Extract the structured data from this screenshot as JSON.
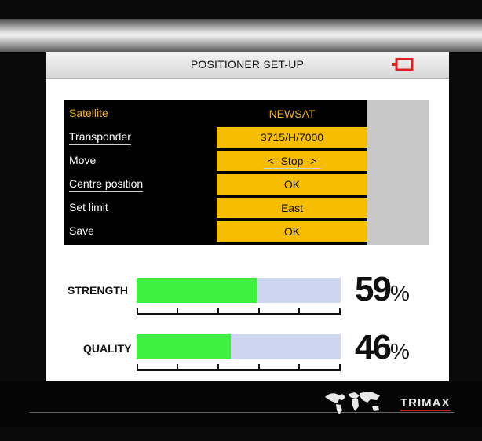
{
  "header": {
    "title": "POSITIONER SET-UP",
    "icon": "power-plug-icon",
    "icon_color": "#e02020"
  },
  "menu": {
    "items": [
      {
        "label": "Satellite",
        "value": "NEWSAT",
        "selected": true
      },
      {
        "label": "Transponder",
        "value": "3715/H/7000"
      },
      {
        "label": "Move",
        "value": "<- Stop ->"
      },
      {
        "label": "Centre position",
        "value": "OK"
      },
      {
        "label": "Set limit",
        "value": "East"
      },
      {
        "label": "Save",
        "value": "OK"
      }
    ]
  },
  "meters": {
    "strength": {
      "label": "STRENGTH",
      "value": 59,
      "unit": "%"
    },
    "quality": {
      "label": "QUALITY",
      "value": 46,
      "unit": "%"
    }
  },
  "footer": {
    "brand": "TRIMAX",
    "icon": "world-map-icon"
  },
  "colors": {
    "highlight": "#f7bd00",
    "selected_text": "#f3b21a",
    "bar_fill": "#3ff03f",
    "bar_track": "#cdd6ee"
  }
}
